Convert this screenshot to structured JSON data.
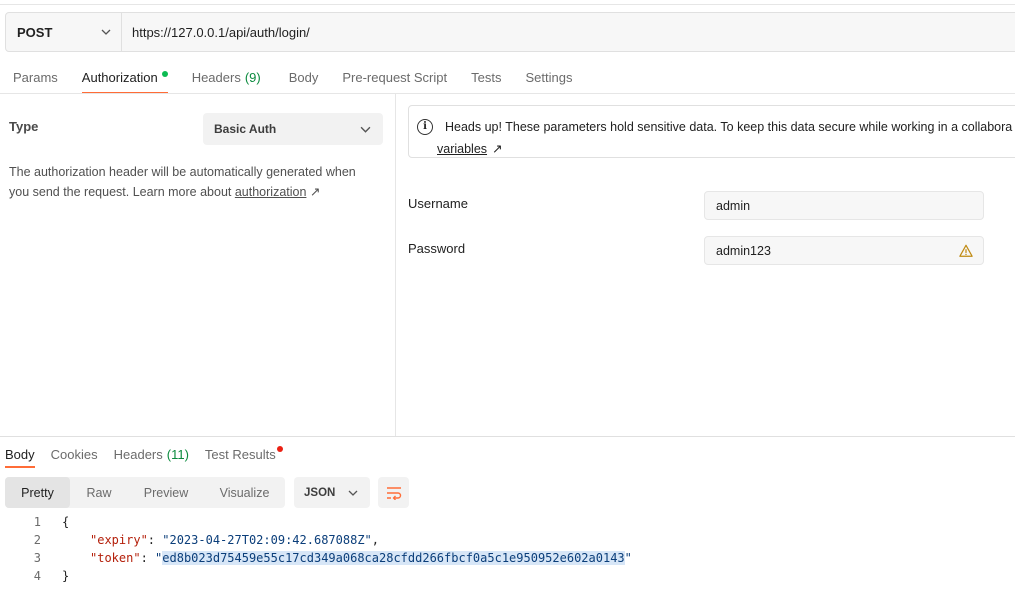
{
  "request": {
    "method": "POST",
    "url": "https://127.0.0.1/api/auth/login/"
  },
  "request_tabs": [
    {
      "label": "Params"
    },
    {
      "label": "Authorization"
    },
    {
      "label": "Headers",
      "count": "(9)"
    },
    {
      "label": "Body"
    },
    {
      "label": "Pre-request Script"
    },
    {
      "label": "Tests"
    },
    {
      "label": "Settings"
    }
  ],
  "auth": {
    "type_label": "Type",
    "type_value": "Basic Auth",
    "description": "The authorization header will be automatically generated when you send the request. Learn more about ",
    "link_text": "authorization",
    "link_arrow": "↗"
  },
  "notice": {
    "text": "Heads up! These parameters hold sensitive data. To keep this data secure while working in a collabora",
    "link_text": "variables",
    "link_arrow": "↗"
  },
  "fields": {
    "username_label": "Username",
    "username_value": "admin",
    "password_label": "Password",
    "password_value": "admin123"
  },
  "response_tabs": [
    {
      "label": "Body"
    },
    {
      "label": "Cookies"
    },
    {
      "label": "Headers",
      "count": "(11)"
    },
    {
      "label": "Test Results"
    }
  ],
  "view_modes": [
    "Pretty",
    "Raw",
    "Preview",
    "Visualize"
  ],
  "format": "JSON",
  "code": {
    "line_numbers": [
      "1",
      "2",
      "3",
      "4"
    ],
    "open_brace": "{",
    "close_brace": "}",
    "expiry_key": "\"expiry\"",
    "expiry_value": "\"2023-04-27T02:09:42.687088Z\"",
    "token_key": "\"token\"",
    "token_value": "ed8b023d75459e55c17cd349a068ca28cfdd266fbcf0a5c1e950952e602a0143"
  },
  "colors": {
    "accent": "#ff6c37",
    "status_green": "#0cbb52",
    "alert_red": "#eb2013",
    "warning": "#c08a12"
  }
}
